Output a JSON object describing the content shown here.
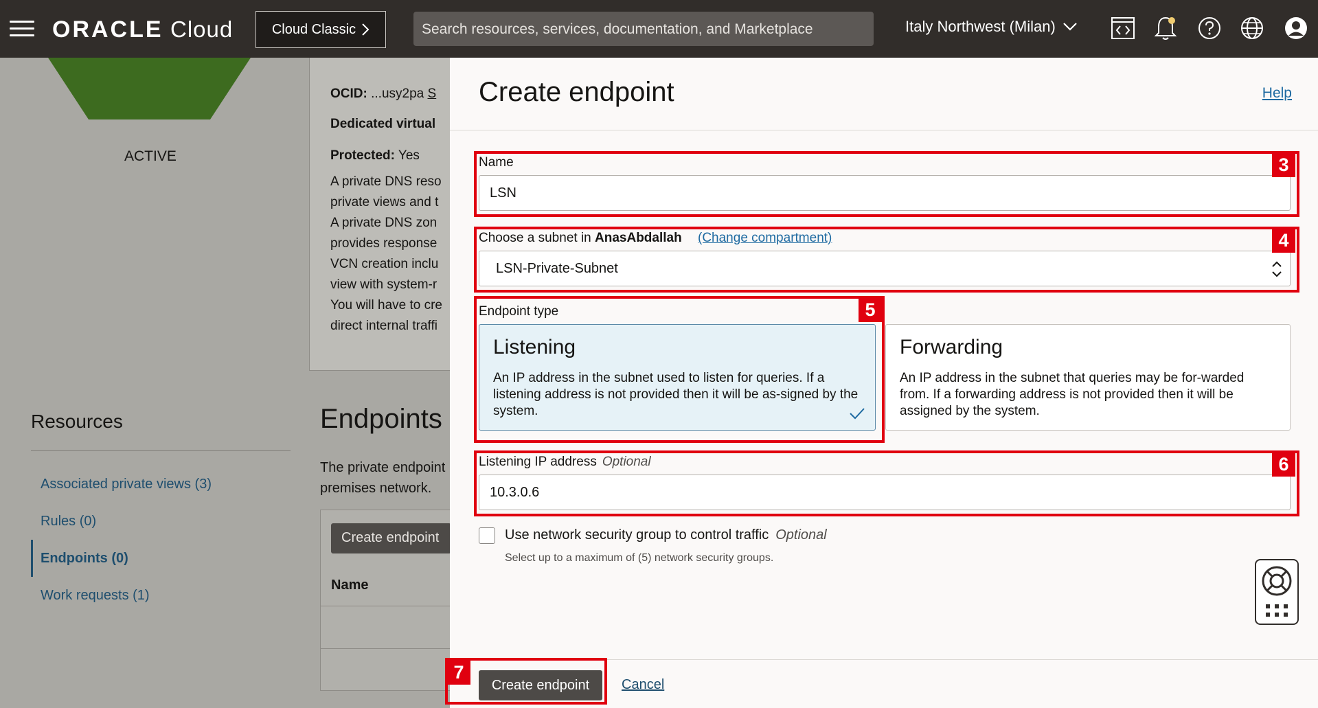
{
  "topbar": {
    "logo_brand": "ORACLE",
    "logo_product": "Cloud",
    "classic_button": "Cloud Classic",
    "search_placeholder": "Search resources, services, documentation, and Marketplace",
    "region": "Italy Northwest (Milan)"
  },
  "background": {
    "status": "ACTIVE",
    "ocid_label": "OCID:",
    "ocid_value": "...usy2pa",
    "ocid_more": "S",
    "dedicated": "Dedicated virtual",
    "protected_label": "Protected:",
    "protected_value": "Yes",
    "desc_lines": [
      "A private DNS reso",
      "private views and t",
      "A private DNS zon",
      "provides response",
      "VCN creation inclu",
      "view with system-r",
      "You will have to cre",
      "direct internal traffi"
    ],
    "resources_title": "Resources",
    "resource_links": [
      "Associated private views (3)",
      "Rules (0)",
      "Endpoints (0)",
      "Work requests (1)"
    ],
    "endpoints_title": "Endpoints",
    "endpoints_desc": [
      "The private endpoint",
      "premises network."
    ],
    "create_button": "Create endpoint",
    "table_name_header": "Name"
  },
  "panel": {
    "title": "Create endpoint",
    "help": "Help",
    "name_label": "Name",
    "name_value": "LSN",
    "subnet_label": "Choose a subnet in",
    "subnet_compartment": "AnasAbdallah",
    "subnet_change": "(Change compartment)",
    "subnet_value": "LSN-Private-Subnet",
    "endpoint_type_label": "Endpoint type",
    "listening_title": "Listening",
    "listening_desc": "An IP address in the subnet used to listen for queries. If a listening address is not provided then it will be as-signed by the system.",
    "forwarding_title": "Forwarding",
    "forwarding_desc": "An IP address in the subnet that queries may be for-warded from. If a forwarding address is not provided then it will be assigned by the system.",
    "listening_ip_label": "Listening IP address",
    "optional": "Optional",
    "listening_ip_value": "10.3.0.6",
    "nsg_label": "Use network security group to control traffic",
    "nsg_hint": "Select up to a maximum of (5) network security groups.",
    "create_button": "Create endpoint",
    "cancel": "Cancel"
  },
  "callouts": [
    "3",
    "4",
    "5",
    "6",
    "7"
  ],
  "colors": {
    "accent_red": "#e0000f",
    "topbar": "#312d2a",
    "selected_card": "#e6f2f7",
    "link": "#1e6aa1"
  }
}
